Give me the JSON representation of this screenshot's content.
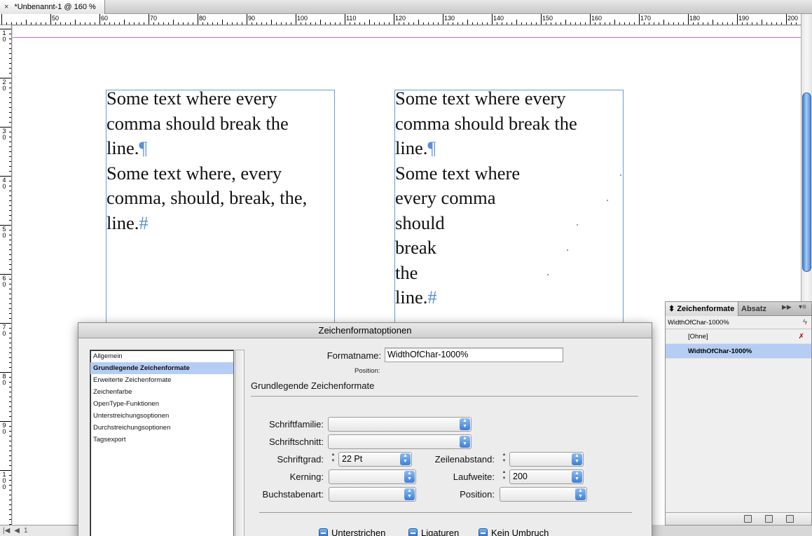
{
  "tab": {
    "title": "*Unbenannt-1 @ 160 %",
    "close": "×"
  },
  "ruler": {
    "h_labels": [
      "50",
      "60",
      "70",
      "80",
      "90",
      "100",
      "110",
      "120",
      "130",
      "140",
      "150",
      "160",
      "170",
      "180",
      "190",
      "200"
    ],
    "v_labels": [
      "10",
      "20",
      "30",
      "40",
      "50",
      "60",
      "70",
      "80",
      "90",
      "100"
    ]
  },
  "frame_left": {
    "lines": [
      "Some text where every",
      "comma should break the",
      "line.",
      "Some text where, every",
      "comma, should, break, the,",
      "line."
    ],
    "pilcrow": "¶",
    "end_mark": "#"
  },
  "frame_right": {
    "lines": [
      "Some text where every",
      "comma should break the",
      "line.",
      "Some text where",
      "every comma",
      "should",
      "break",
      "the",
      "line."
    ],
    "pilcrow": "¶",
    "end_mark": "#"
  },
  "status": {
    "page": "1"
  },
  "dialog": {
    "title": "Zeichenformatoptionen",
    "categories": [
      "Allgemein",
      "Grundlegende Zeichenformate",
      "Erweiterte Zeichenformate",
      "Zeichenfarbe",
      "OpenType-Funktionen",
      "Unterstreichungsoptionen",
      "Durchstreichungsoptionen",
      "Tagsexport"
    ],
    "selected_category": "Grundlegende Zeichenformate",
    "format_name_label": "Formatname:",
    "format_name_value": "WidthOfChar-1000%",
    "position_label": "Position:",
    "section_title": "Grundlegende Zeichenformate",
    "fields": {
      "schriftfamilie": {
        "label": "Schriftfamilie:",
        "value": ""
      },
      "schriftschnitt": {
        "label": "Schriftschnitt:",
        "value": ""
      },
      "schriftgrad": {
        "label": "Schriftgrad:",
        "value": "22 Pt"
      },
      "zeilenabstand": {
        "label": "Zeilenabstand:",
        "value": ""
      },
      "kerning": {
        "label": "Kerning:",
        "value": ""
      },
      "laufweite": {
        "label": "Laufweite:",
        "value": "200"
      },
      "buchstabenart": {
        "label": "Buchstabenart:",
        "value": ""
      },
      "position": {
        "label": "Position:",
        "value": ""
      }
    },
    "checkboxes": [
      "Unterstrichen",
      "Ligaturen",
      "Kein Umbruch"
    ]
  },
  "panel": {
    "tab_active": "Zeichenformate",
    "tab_inactive": "Absatz",
    "current_style": "WidthOfChar-1000%",
    "styles": [
      "[Ohne]",
      "WidthOfChar-1000%"
    ],
    "selected_style": "WidthOfChar-1000%"
  },
  "colors": {
    "accent": "#3c7fd8",
    "frame": "#6b9bd1",
    "margin": "#d35fd3",
    "selection": "#b5cdf5"
  }
}
